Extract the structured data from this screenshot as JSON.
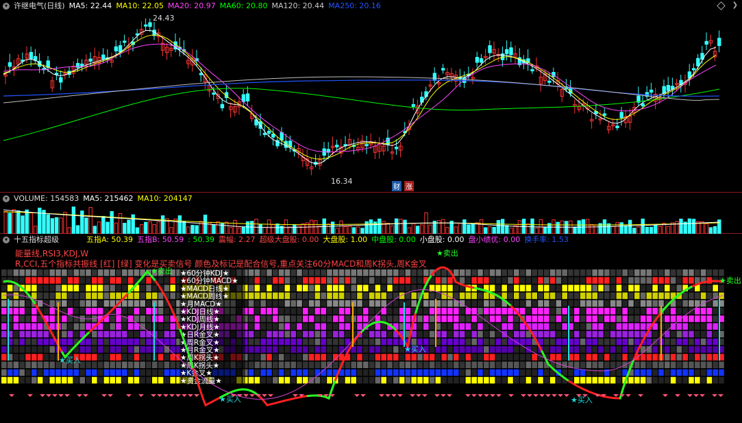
{
  "price_panel": {
    "title": "许继电气(日线)",
    "ma": [
      {
        "label": "MA5: 22.44",
        "color": "#ffffff"
      },
      {
        "label": "MA10: 22.05",
        "color": "#ffff00"
      },
      {
        "label": "MA20: 20.97",
        "color": "#ff44ff"
      },
      {
        "label": "MA60: 20.80",
        "color": "#00ff00"
      },
      {
        "label": "MA120: 20.44",
        "color": "#c0c0c0"
      },
      {
        "label": "MA250: 20.16",
        "color": "#2255ff"
      }
    ],
    "high_label": "24.43",
    "low_label": "16.34",
    "flag_cai": "财",
    "flag_zhang": "涨"
  },
  "volume_panel": {
    "label": "VOLUME: 154583",
    "ma5": "MA5: 215462",
    "ma10": "MA10: 204147"
  },
  "indicator_panel": {
    "title": "十五指标超级",
    "stats": [
      {
        "label": "五指A: 50.39",
        "color": "#ffff00"
      },
      {
        "label": "五指B: 50.59",
        "color": "#ff44ff"
      },
      {
        "label": ": 50.39",
        "color": "#00ff00"
      },
      {
        "label": "震幅: 2.27",
        "color": "#ff4444"
      },
      {
        "label": "超级大盘股: 0.00",
        "color": "#ff4444"
      },
      {
        "label": "大盘股: 1.00",
        "color": "#ffff00"
      },
      {
        "label": "中盘股: 0.00",
        "color": "#00ff00"
      },
      {
        "label": "小盘股: 0.00",
        "color": "#ffffff"
      },
      {
        "label": "盘小绩优: 0.00",
        "color": "#ff44ff"
      },
      {
        "label": "换手率: 1.53",
        "color": "#2255ff"
      }
    ],
    "note1": "能量线,RSI3,KDJ,W",
    "note2": "R,CCI,五个指标共振线 [红] [绿] 变化是买卖信号 颜色及标记是配合信号,重点关注60分MACD和周K拐头,周K金叉",
    "legend": [
      "60分钟KDJ",
      "60分钟MACD",
      "MACD日线",
      "MACD周线",
      "月MACD",
      "KDJ日线",
      "KDJ周线",
      "KDJ月线",
      "日R金叉",
      "周R金叉",
      "月R金叉",
      "周K拐头",
      "周K拐头",
      "K金叉",
      "资金流量"
    ],
    "buy_label": "买入",
    "sell_label": "卖出"
  }
}
